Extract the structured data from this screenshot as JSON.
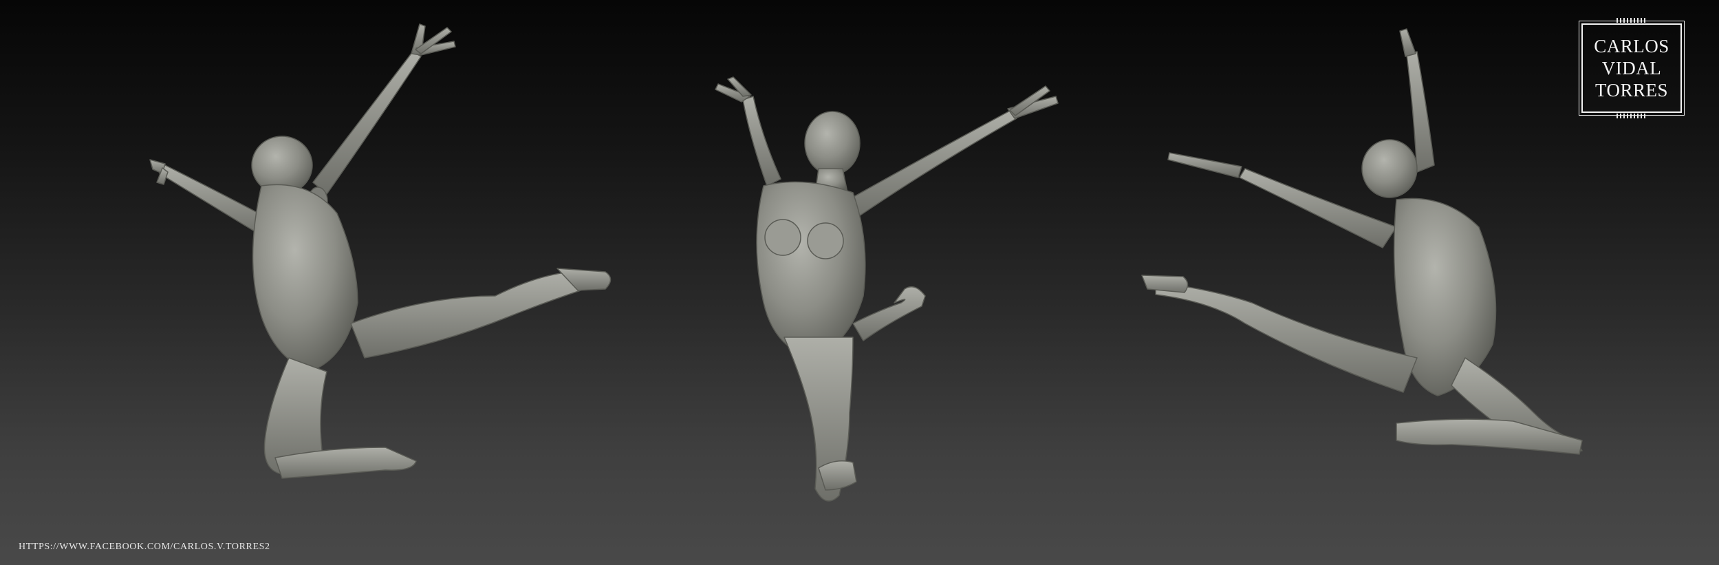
{
  "logo": {
    "line1": "CARLOS",
    "line2": "VIDAL",
    "line3": "TORRES"
  },
  "credit": {
    "url": "HTTPS://WWW.FACEBOOK.COM/CARLOS.V.TORRES2"
  },
  "colors": {
    "background_top": "#060606",
    "background_bottom": "#494949",
    "sculpt_light": "#a9aaa3",
    "sculpt_mid": "#85867f",
    "sculpt_dark": "#5b5c56"
  },
  "figures": [
    {
      "name": "dancer-back-view"
    },
    {
      "name": "dancer-front-view"
    },
    {
      "name": "dancer-side-view"
    }
  ]
}
